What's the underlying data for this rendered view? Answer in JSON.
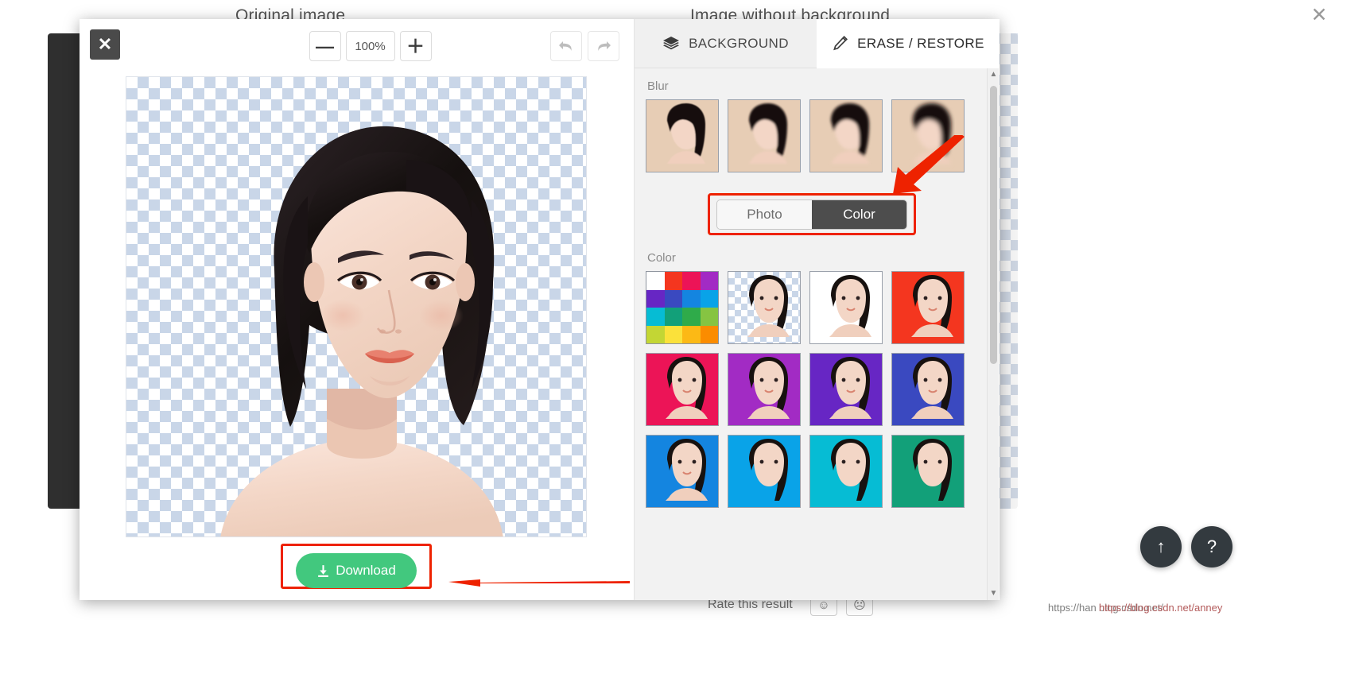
{
  "background_page": {
    "heading_original": "Original image",
    "heading_no_background": "Image without background",
    "close_glyph": "✕",
    "rate_label": "Rate this result",
    "rate_good_icon": "☺",
    "rate_bad_icon": "☹",
    "scroll_top_icon": "↑",
    "help_icon": "?",
    "watermark_1": "https://han",
    "watermark_2": "blog.csdn.net/",
    "watermark_3": "https://blog.csdn.net/anney"
  },
  "editor": {
    "close_icon": "✕",
    "zoom": {
      "minus_label": "—",
      "value": "100%",
      "plus_label": "＋"
    },
    "history": {
      "undo_icon": "undo-icon",
      "redo_icon": "redo-icon"
    },
    "download": {
      "label": "Download",
      "icon": "download-icon",
      "color": "#42c87e",
      "highlight_color": "#ee2200"
    },
    "annotation_arrow_color": "#ee2200"
  },
  "side_panel": {
    "tabs": [
      {
        "label": "BACKGROUND",
        "icon": "layers-icon",
        "active": false
      },
      {
        "label": "ERASE / RESTORE",
        "icon": "pencil-icon",
        "active": true
      }
    ],
    "blur": {
      "label": "Blur",
      "thumbnails": [
        {
          "name": "blur-level-1",
          "bg": "#e7cdb5",
          "blur": 0.6
        },
        {
          "name": "blur-level-2",
          "bg": "#e7cdb5",
          "blur": 1.2
        },
        {
          "name": "blur-level-3",
          "bg": "#e7cdb5",
          "blur": 1.8
        },
        {
          "name": "blur-level-4",
          "bg": "#e7cdb5",
          "blur": 2.6
        }
      ]
    },
    "mode_toggle": {
      "photo_label": "Photo",
      "color_label": "Color",
      "selected": "Color",
      "highlight_color": "#ee2200"
    },
    "color": {
      "label": "Color",
      "palette_swatches": [
        "#ffffff",
        "#f4361f",
        "#ec1457",
        "#a22bc4",
        "#6726c4",
        "#3a49c0",
        "#1485e0",
        "#09a3e8",
        "#06bcd4",
        "#12a079",
        "#2fab4a",
        "#86c442",
        "#c3d634",
        "#fbe13a",
        "#fcb915",
        "#fb8c00"
      ],
      "swatches": [
        {
          "name": "transparent-swatch",
          "color": "transparent"
        },
        {
          "name": "white-swatch",
          "color": "#ffffff"
        },
        {
          "name": "red-orange-swatch",
          "color": "#f4361f"
        },
        {
          "name": "pink-swatch",
          "color": "#ec1457"
        },
        {
          "name": "purple-swatch",
          "color": "#a22bc4"
        },
        {
          "name": "violet-swatch",
          "color": "#6726c4"
        },
        {
          "name": "indigo-swatch",
          "color": "#3a49c0"
        },
        {
          "name": "blue-swatch",
          "color": "#1485e0"
        },
        {
          "name": "light-blue-swatch",
          "color": "#09a3e8"
        },
        {
          "name": "cyan-swatch",
          "color": "#06bcd4"
        },
        {
          "name": "teal-swatch",
          "color": "#12a079"
        }
      ]
    },
    "scrollbar": {
      "up_icon": "▲",
      "down_icon": "▼"
    }
  }
}
